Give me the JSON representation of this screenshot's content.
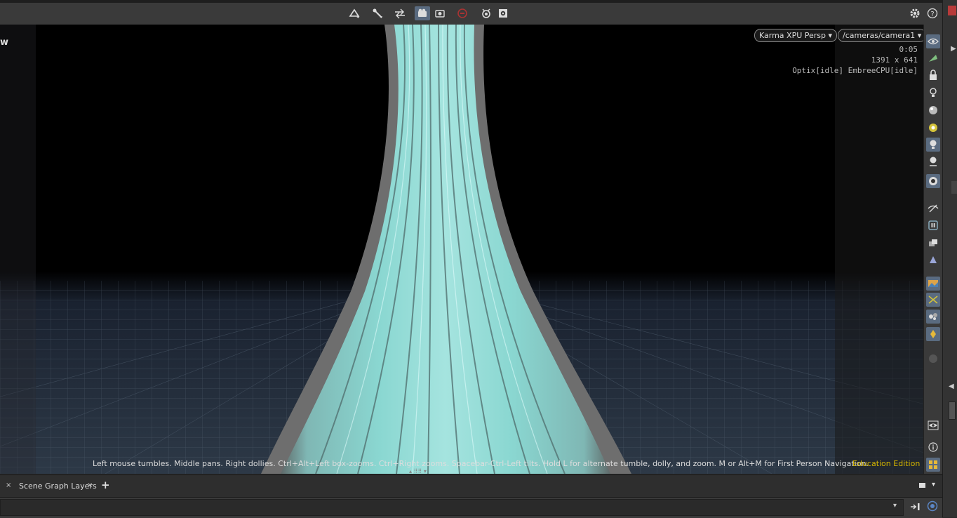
{
  "viewport": {
    "title_fragment": "w",
    "renderer_menu": "Karma XPU Persp",
    "camera_menu": "/cameras/camera1",
    "render_time": "0:05",
    "resolution": "1391 x 641",
    "device_status": "Optix[idle] EmbreeCPU[idle]",
    "hint": "Left mouse tumbles. Middle pans. Right dollies. Ctrl+Alt+Left box-zooms. Ctrl+Right zooms. Spacebar-Ctrl-Left tilts. Hold L for alternate tumble, dolly, and zoom. M or Alt+M for First Person Navigation.",
    "edition": "Education Edition"
  },
  "tabs": {
    "close_left": "×",
    "scene_graph_layers": "Scene Graph Layers",
    "close_tab": "×",
    "add": "+"
  },
  "colors": {
    "accent_active": "#5a6b80",
    "edition_yellow": "#d4b400",
    "mesh_cyan": "#7fcfc8"
  }
}
